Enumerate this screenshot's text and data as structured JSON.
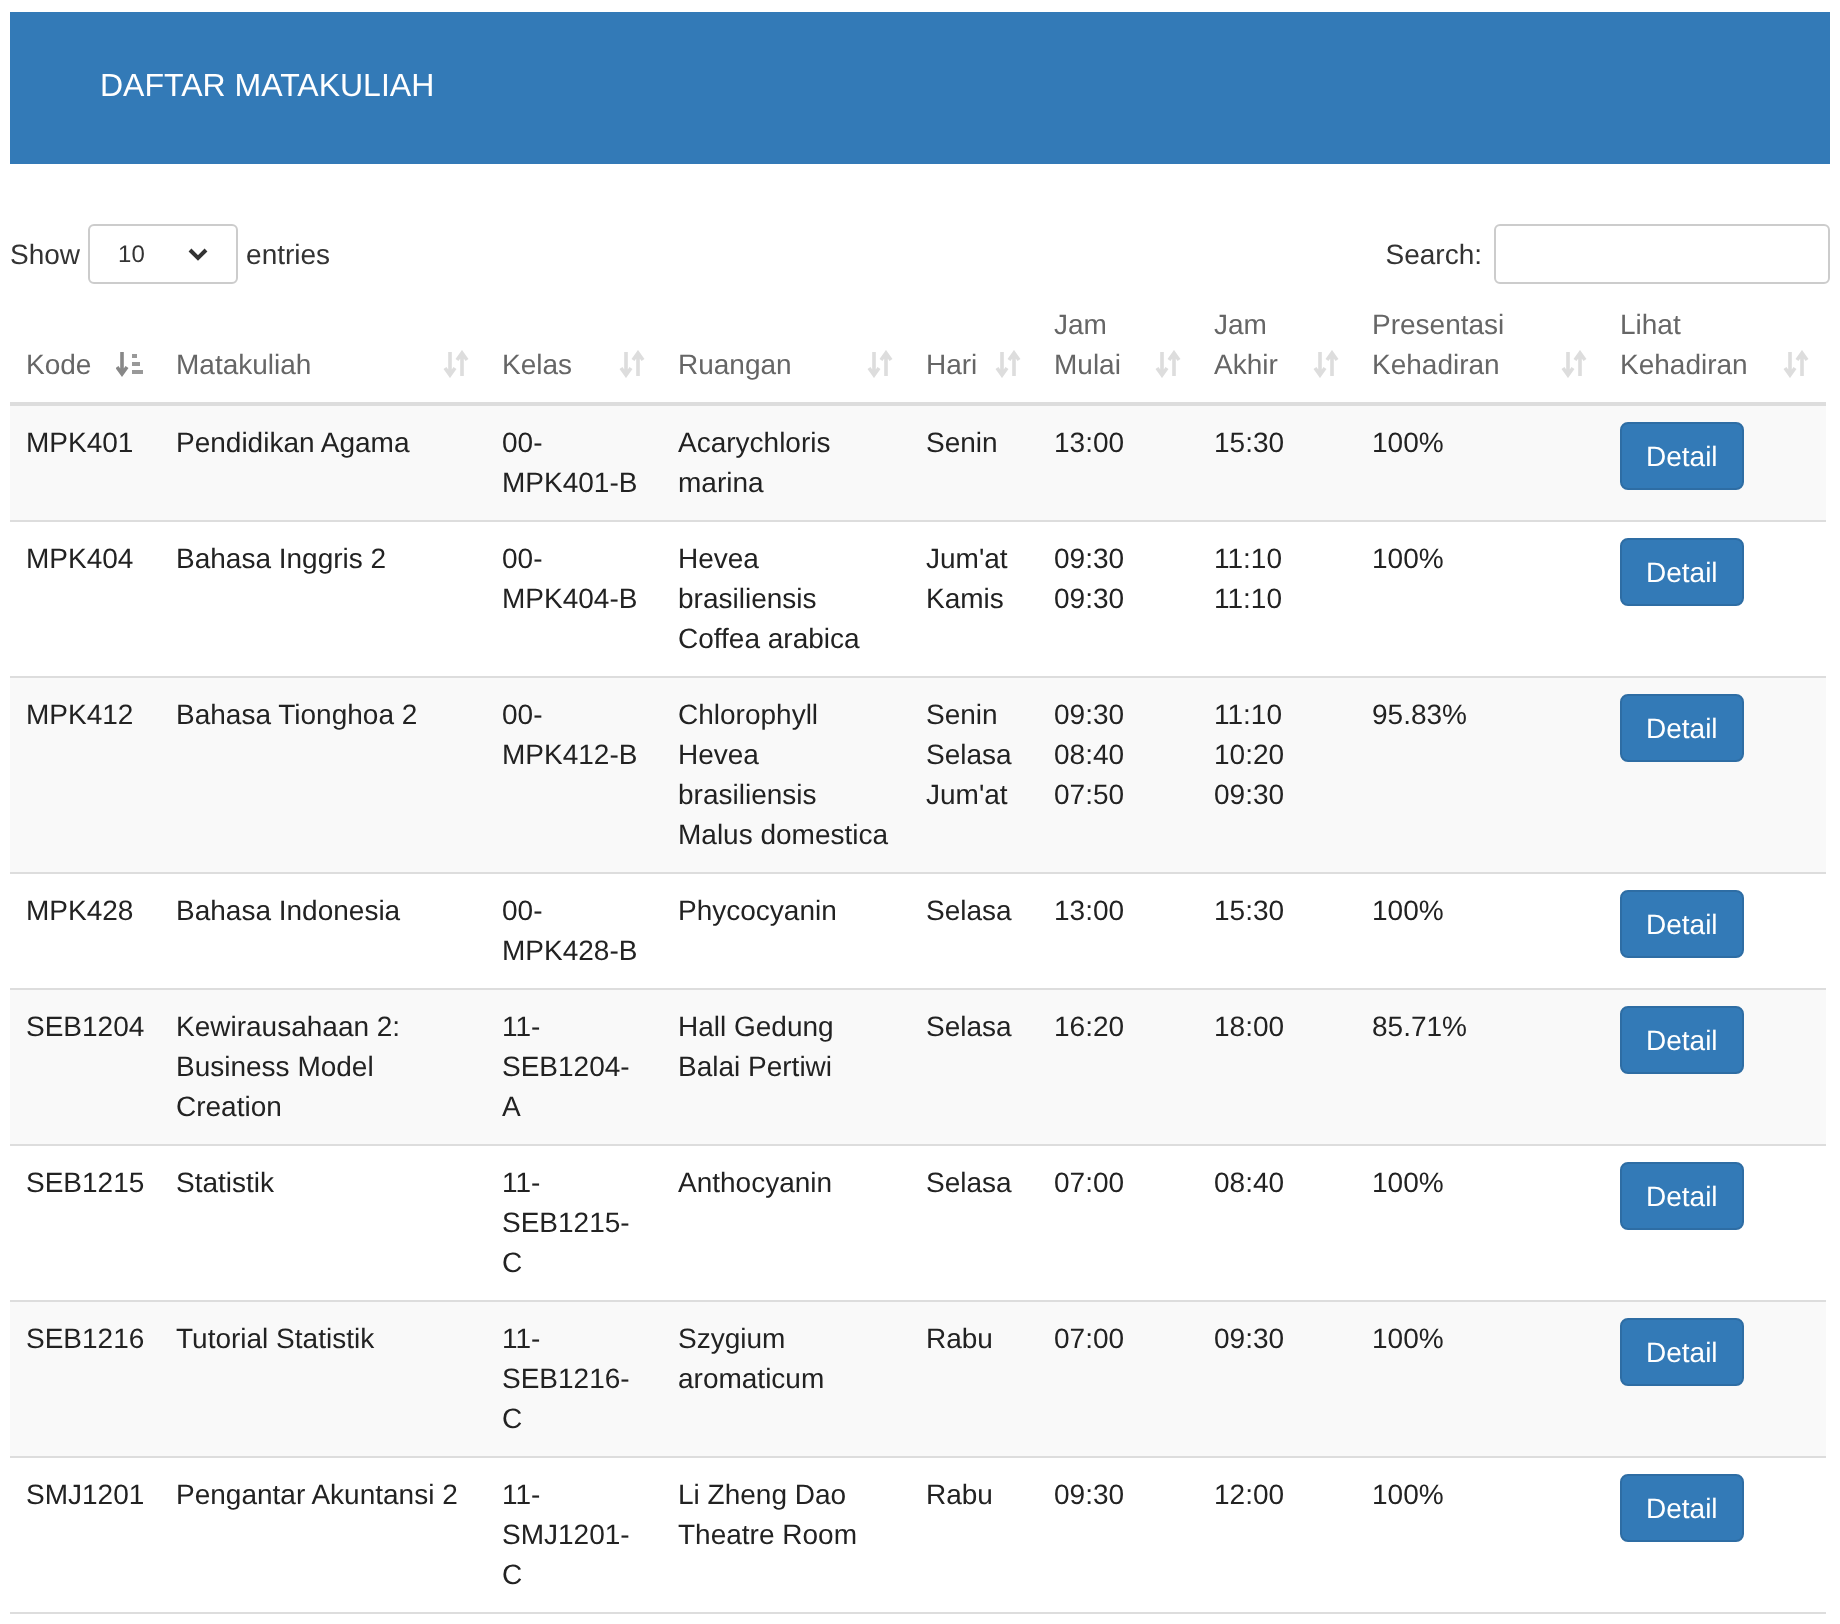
{
  "header": {
    "title": "DAFTAR MATAKULIAH"
  },
  "length_menu": {
    "prefix": "Show",
    "value": "10",
    "suffix": "entries"
  },
  "search": {
    "label": "Search:"
  },
  "table": {
    "columns": [
      {
        "label": "Kode",
        "sorted": true
      },
      {
        "label": "Matakuliah",
        "sorted": false
      },
      {
        "label": "Kelas",
        "sorted": false
      },
      {
        "label": "Ruangan",
        "sorted": false
      },
      {
        "label": "Hari",
        "sorted": false
      },
      {
        "label": "Jam Mulai",
        "sorted": false
      },
      {
        "label": "Jam Akhir",
        "sorted": false
      },
      {
        "label": "Presentasi Kehadiran",
        "sorted": false
      },
      {
        "label": "Lihat Kehadiran",
        "sorted": false
      }
    ],
    "rows": [
      {
        "kode": "MPK401",
        "matakuliah": "Pendidikan Agama",
        "kelas": "00-MPK401-B",
        "ruangan": [
          "Acarychloris marina"
        ],
        "hari": [
          "Senin"
        ],
        "mulai": [
          "13:00"
        ],
        "akhir": [
          "15:30"
        ],
        "presentasi": "100%",
        "button": "Detail"
      },
      {
        "kode": "MPK404",
        "matakuliah": "Bahasa Inggris 2",
        "kelas": "00-MPK404-B",
        "ruangan": [
          "Hevea brasiliensis",
          "Coffea arabica"
        ],
        "hari": [
          "Jum'at",
          "Kamis"
        ],
        "mulai": [
          "09:30",
          "09:30"
        ],
        "akhir": [
          "11:10",
          "11:10"
        ],
        "presentasi": "100%",
        "button": "Detail"
      },
      {
        "kode": "MPK412",
        "matakuliah": "Bahasa Tionghoa 2",
        "kelas": "00-MPK412-B",
        "ruangan": [
          "Chlorophyll",
          "Hevea brasiliensis",
          "Malus domestica"
        ],
        "hari": [
          "Senin",
          "Selasa",
          "Jum'at"
        ],
        "mulai": [
          "09:30",
          "08:40",
          "07:50"
        ],
        "akhir": [
          "11:10",
          "10:20",
          "09:30"
        ],
        "presentasi": "95.83%",
        "button": "Detail"
      },
      {
        "kode": "MPK428",
        "matakuliah": "Bahasa Indonesia",
        "kelas": "00-MPK428-B",
        "ruangan": [
          "Phycocyanin"
        ],
        "hari": [
          "Selasa"
        ],
        "mulai": [
          "13:00"
        ],
        "akhir": [
          "15:30"
        ],
        "presentasi": "100%",
        "button": "Detail"
      },
      {
        "kode": "SEB1204",
        "matakuliah": "Kewirausahaan 2: Business Model Creation",
        "kelas": "11-SEB1204-A",
        "ruangan": [
          "Hall Gedung Balai Pertiwi"
        ],
        "hari": [
          "Selasa"
        ],
        "mulai": [
          "16:20"
        ],
        "akhir": [
          "18:00"
        ],
        "presentasi": "85.71%",
        "button": "Detail"
      },
      {
        "kode": "SEB1215",
        "matakuliah": "Statistik",
        "kelas": "11-SEB1215-C",
        "ruangan": [
          "Anthocyanin"
        ],
        "hari": [
          "Selasa"
        ],
        "mulai": [
          "07:00"
        ],
        "akhir": [
          "08:40"
        ],
        "presentasi": "100%",
        "button": "Detail"
      },
      {
        "kode": "SEB1216",
        "matakuliah": "Tutorial Statistik",
        "kelas": "11-SEB1216-C",
        "ruangan": [
          "Szygium aromaticum"
        ],
        "hari": [
          "Rabu"
        ],
        "mulai": [
          "07:00"
        ],
        "akhir": [
          "09:30"
        ],
        "presentasi": "100%",
        "button": "Detail"
      },
      {
        "kode": "SMJ1201",
        "matakuliah": "Pengantar Akuntansi 2",
        "kelas": "11-SMJ1201-C",
        "ruangan": [
          "Li Zheng Dao Theatre Room"
        ],
        "hari": [
          "Rabu"
        ],
        "mulai": [
          "09:30"
        ],
        "akhir": [
          "12:00"
        ],
        "presentasi": "100%",
        "button": "Detail"
      }
    ]
  }
}
